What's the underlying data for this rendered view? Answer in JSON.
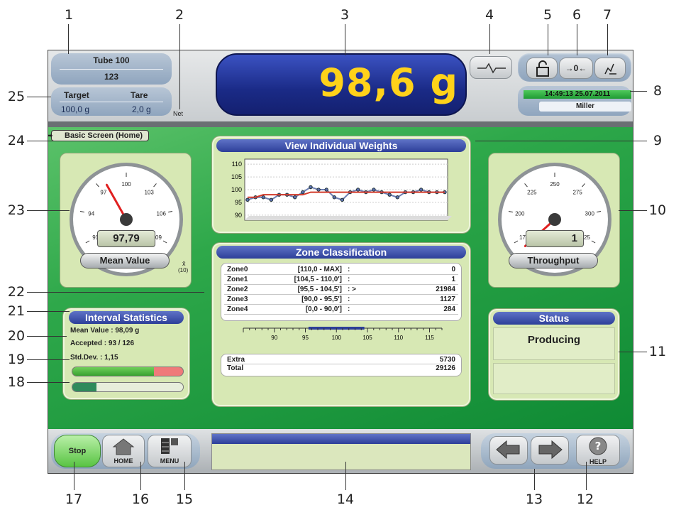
{
  "callouts": [
    "1",
    "2",
    "3",
    "4",
    "5",
    "6",
    "7",
    "8",
    "9",
    "10",
    "11",
    "12",
    "13",
    "14",
    "15",
    "16",
    "17",
    "18",
    "19",
    "20",
    "21",
    "22",
    "23",
    "24",
    "25"
  ],
  "header": {
    "product_name": "Tube 100",
    "product_code": "123",
    "target_label": "Target",
    "tare_label": "Tare",
    "target_value": "100,0 g",
    "tare_value": "2,0 g",
    "net_label": "Net",
    "weight_display": "98,6 g",
    "zero_label": "→0←",
    "datetime": "14:49:13  25.07.2011",
    "user": "Miller"
  },
  "breadcrumb": "Basic Screen (Home)",
  "mean_gauge": {
    "value_display": "97,79",
    "label": "Mean Value",
    "scale_labels": [
      "91",
      "94",
      "97",
      "100",
      "103",
      "106",
      "109"
    ],
    "x_label": "x̄",
    "n_label": "(10)",
    "value": 97.79,
    "min": 91,
    "max": 109
  },
  "throughput_gauge": {
    "value_display": "1",
    "label": "Throughput",
    "scale_labels": [
      "175",
      "200",
      "225",
      "250",
      "275",
      "300",
      "325"
    ],
    "value": 165,
    "min": 175,
    "max": 325
  },
  "individual_weights": {
    "title": "View Individual Weights",
    "chart_data": {
      "type": "line",
      "title": "",
      "xlabel": "",
      "ylabel": "",
      "ylim": [
        88,
        112
      ],
      "y_ticks": [
        90,
        95,
        100,
        105,
        110
      ],
      "x": [
        1,
        2,
        3,
        4,
        5,
        6,
        7,
        8,
        9,
        10,
        11,
        12,
        13,
        14,
        15,
        16,
        17,
        18,
        19,
        20,
        21,
        22,
        23,
        24,
        25,
        26
      ],
      "series": [
        {
          "values": [
            96,
            97,
            97,
            96,
            98,
            98,
            97,
            99,
            101,
            100,
            100,
            97,
            96,
            99,
            100,
            99,
            100,
            99,
            98,
            97,
            99,
            99,
            100,
            99,
            99,
            99
          ]
        },
        {
          "values": [
            97,
            97,
            98,
            98,
            98,
            98,
            98,
            98,
            99,
            99,
            99,
            99,
            99,
            99,
            99,
            99,
            99,
            99,
            99,
            99,
            99,
            99,
            99,
            99,
            99,
            99
          ]
        }
      ],
      "grid": true
    }
  },
  "zone_classification": {
    "title": "Zone Classification",
    "rows": [
      {
        "zone": "Zone0",
        "range": "[110,0 - MAX]",
        "mark": ":",
        "count": "0"
      },
      {
        "zone": "Zone1",
        "range": "[104,5 - 110,0']",
        "mark": ":",
        "count": "1"
      },
      {
        "zone": "Zone2",
        "range": "[95,5 - 104,5']",
        "mark": ": >",
        "count": "21984"
      },
      {
        "zone": "Zone3",
        "range": "[90,0 - 95,5']",
        "mark": ":",
        "count": "1127"
      },
      {
        "zone": "Zone4",
        "range": "[0,0 - 90,0']",
        "mark": ":",
        "count": "284"
      }
    ],
    "scale_ticks": [
      "90",
      "95",
      "100",
      "105",
      "110",
      "115"
    ],
    "extra_label": "Extra",
    "extra_value": "5730",
    "total_label": "Total",
    "total_value": "29126"
  },
  "interval_stats": {
    "title": "Interval Statistics",
    "mean": "Mean Value : 98,09 g",
    "accepted": "Accepted : 93 / 126",
    "stddev": "Std.Dev. : 1,15",
    "accepted_fraction": 0.74,
    "progress_fraction": 0.22
  },
  "status": {
    "title": "Status",
    "value": "Producing"
  },
  "footer": {
    "stop_label": "Stop",
    "home_label": "HOME",
    "menu_label": "MENU",
    "help_label": "HELP"
  },
  "colors": {
    "accent_blue": "#2d3f99",
    "weight_text": "#ffd21a",
    "green_bg": "#2ea84a",
    "panel_bg": "#d7e8b4"
  }
}
